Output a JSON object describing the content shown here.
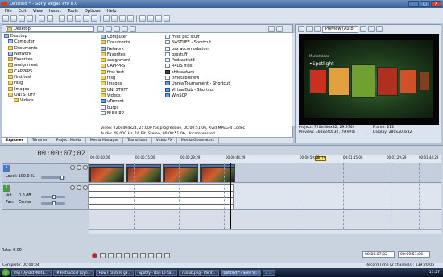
{
  "window": {
    "title": "Untitled * - Sony Vegas Pro 8.0",
    "controls": [
      "_",
      "□",
      "X"
    ]
  },
  "menu": [
    "File",
    "Edit",
    "View",
    "Insert",
    "Tools",
    "Options",
    "Help"
  ],
  "explorer": {
    "path": "Desktop",
    "tree": [
      {
        "label": "Desktop",
        "icon": "desktop-icon",
        "indent": 0
      },
      {
        "label": "Computer",
        "icon": "computer-icon",
        "indent": 1
      },
      {
        "label": "Documents",
        "icon": "folder-icon",
        "indent": 1
      },
      {
        "label": "Network",
        "icon": "network-icon",
        "indent": 1
      },
      {
        "label": "Favorites",
        "icon": "folder-icon",
        "indent": 1
      },
      {
        "label": "assignment",
        "icon": "folder-icon",
        "indent": 1
      },
      {
        "label": "CAPPPPS",
        "icon": "folder-icon",
        "indent": 1
      },
      {
        "label": "first test",
        "icon": "folder-icon",
        "indent": 1
      },
      {
        "label": "fssg",
        "icon": "folder-icon",
        "indent": 1
      },
      {
        "label": "Images",
        "icon": "folder-icon",
        "indent": 1
      },
      {
        "label": "UNI STUFF",
        "icon": "folder-icon",
        "indent": 1
      },
      {
        "label": "Videos",
        "icon": "folder-icon",
        "indent": 2
      }
    ],
    "files_col1": [
      {
        "label": "Computer",
        "icon": "computer-icon"
      },
      {
        "label": "Documents",
        "icon": "folder-icon"
      },
      {
        "label": "Network",
        "icon": "network-icon"
      },
      {
        "label": "Favorites",
        "icon": "folder-icon"
      },
      {
        "label": "assignment",
        "icon": "folder-icon"
      },
      {
        "label": "CAPPPPS",
        "icon": "folder-icon"
      },
      {
        "label": "first test",
        "icon": "folder-icon"
      },
      {
        "label": "fssg",
        "icon": "folder-icon"
      },
      {
        "label": "Images",
        "icon": "folder-icon"
      },
      {
        "label": "UNI STUFF",
        "icon": "folder-icon"
      },
      {
        "label": "Videos",
        "icon": "folder-icon"
      },
      {
        "label": "uTorrent",
        "icon": "app-icon"
      },
      {
        "label": "burps",
        "icon": "file-icon"
      },
      {
        "label": "BUUURP",
        "icon": "file-icon"
      }
    ],
    "files_col2": [
      {
        "label": "misc psx stuff",
        "icon": "file-icon"
      },
      {
        "label": "NASTUFF - Shortcut",
        "icon": "file-icon"
      },
      {
        "label": "psx accomodation",
        "icon": "file-icon"
      },
      {
        "label": "pssstuff",
        "icon": "file-icon"
      },
      {
        "label": "Podcastfst3",
        "icon": "file-icon"
      },
      {
        "label": "R4DS files",
        "icon": "file-icon"
      },
      {
        "label": "shitcapture",
        "icon": "video-icon"
      },
      {
        "label": "timetablenew",
        "icon": "file-icon"
      },
      {
        "label": "UnrealTournament - Shortcut",
        "icon": "app-icon"
      },
      {
        "label": "VirtualDub - Shortcut",
        "icon": "app-icon"
      },
      {
        "label": "WinSCP",
        "icon": "app-icon"
      }
    ],
    "info_line1": "Video: 720x404x24, 25.000 fps progressive, 00:00:51:06, Xvid MPEG-4 Codec",
    "info_line2": "Audio: 48,000 Hz, 16 Bit, Stereo, 00:00:51:06, Uncompressed"
  },
  "tabs": [
    "Explorer",
    "Trimmer",
    "Project Media",
    "Media Manager",
    "Transitions",
    "Video FX",
    "Media Generators"
  ],
  "preview": {
    "mode": "Preview (Auto)",
    "screen_header": "Marketplace",
    "screen_title": "•Spotlight",
    "project_label": "Project:",
    "project_value": "720x480x32, 29.970i",
    "preview_label": "Preview:",
    "preview_value": "360x240x32, 29.970i",
    "frame_label": "Frame:",
    "frame_value": "212",
    "display_label": "Display:",
    "display_value": "280x203x32"
  },
  "timeline": {
    "time": "00:00:07;02",
    "marker": "+1:15",
    "ruler_marks": [
      "00:00:00;00",
      "00:00:15;00",
      "00:00:29;29",
      "00:00:44;29",
      "00:00:59;28",
      "00:01:15;00",
      "00:01:29;29",
      "00:01:44;29"
    ],
    "video_track": {
      "number": "1",
      "level_label": "Level: 100.0 %"
    },
    "audio_track": {
      "number": "2",
      "vol_label": "Vol:",
      "vol_value": "0.0 dB",
      "pan_label": "Pan:",
      "pan_value": "Center"
    },
    "rate": "Rate: 0.00",
    "cursor_time": "00:00:07;02",
    "end_time": "00:00:51;06"
  },
  "status": {
    "left": "Complete: 00:00:04",
    "right": "Record Time (2 channels): 139:20:05"
  },
  "taskbar": {
    "tasks": [
      "mg (DynastyNet-L...",
      "#destructoid (Dyn...",
      "How I capture ga...",
      "Spotify - Dan Le Sa...",
      "runjob.png - Paint...",
      "Untitled * - Sony V...",
      "3 ..."
    ],
    "clock": "13:27"
  }
}
